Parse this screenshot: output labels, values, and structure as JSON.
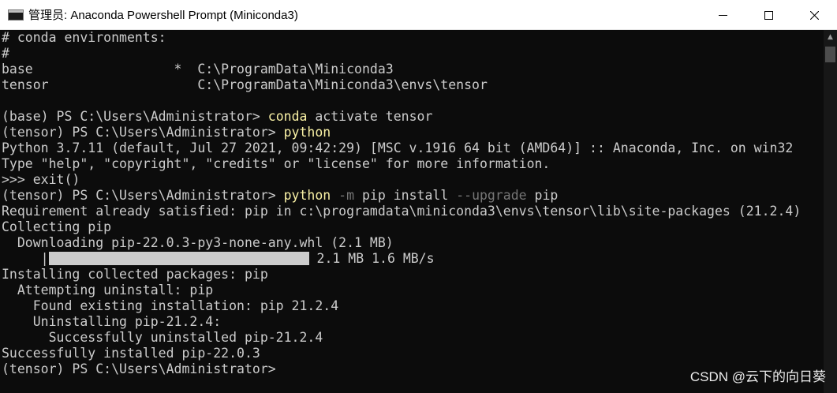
{
  "window": {
    "title": "管理员: Anaconda Powershell Prompt (Miniconda3)",
    "controls": {
      "minimize": "minimize-icon",
      "maximize": "maximize-icon",
      "close": "close-icon"
    }
  },
  "terminal": {
    "lines": [
      {
        "text": "# conda environments:"
      },
      {
        "text": "#"
      },
      {
        "text": "base                  *  C:\\ProgramData\\Miniconda3"
      },
      {
        "text": "tensor                   C:\\ProgramData\\Miniconda3\\envs\\tensor"
      },
      {
        "text": ""
      },
      {
        "prompt": "(base) PS C:\\Users\\Administrator> ",
        "command": "conda",
        "rest": " activate tensor"
      },
      {
        "prompt": "(tensor) PS C:\\Users\\Administrator> ",
        "command": "python"
      },
      {
        "text": "Python 3.7.11 (default, Jul 27 2021, 09:42:29) [MSC v.1916 64 bit (AMD64)] :: Anaconda, Inc. on win32"
      },
      {
        "text": "Type \"help\", \"copyright\", \"credits\" or \"license\" for more information."
      },
      {
        "text": ">>> exit()"
      },
      {
        "prompt": "(tensor) PS C:\\Users\\Administrator> ",
        "command": "python",
        "arg1": " -m",
        "arg2": " pip install",
        "opt2": " --upgrade",
        "rest": " pip"
      },
      {
        "text": "Requirement already satisfied: pip in c:\\programdata\\miniconda3\\envs\\tensor\\lib\\site-packages (21.2.4)"
      },
      {
        "text": "Collecting pip"
      },
      {
        "text": "  Downloading pip-22.0.3-py3-none-any.whl (2.1 MB)"
      },
      {
        "text": "     |",
        "progress": true,
        "rest": " 2.1 MB 1.6 MB/s"
      },
      {
        "text": "Installing collected packages: pip"
      },
      {
        "text": "  Attempting uninstall: pip"
      },
      {
        "text": "    Found existing installation: pip 21.2.4"
      },
      {
        "text": "    Uninstalling pip-21.2.4:"
      },
      {
        "text": "      Successfully uninstalled pip-21.2.4"
      },
      {
        "text": "Successfully installed pip-22.0.3"
      },
      {
        "prompt": "(tensor) PS C:\\Users\\Administrator>"
      }
    ],
    "download_progress": 1.0,
    "colors": {
      "background": "#0c0c0c",
      "foreground": "#cccccc",
      "command": "#f9f1a5",
      "option": "#767676"
    }
  },
  "scrollbar": {
    "up_arrow": "chevron-up-icon"
  },
  "watermark": "CSDN @云下的向日葵"
}
